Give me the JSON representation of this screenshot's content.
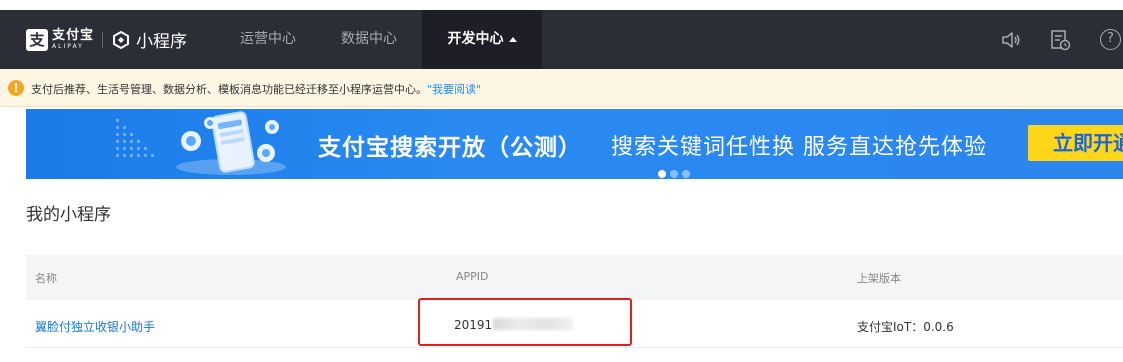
{
  "brand": {
    "alipay_mark": "支",
    "alipay_name": "支付宝",
    "alipay_en": "ALIPAY",
    "product": "小程序"
  },
  "nav": {
    "tabs": [
      {
        "label": "运营中心"
      },
      {
        "label": "数据中心"
      },
      {
        "label": "开发中心",
        "active": true
      }
    ],
    "icons": [
      "speaker-icon",
      "document-clock-icon",
      "help-icon"
    ],
    "help_glyph": "?"
  },
  "notice": {
    "icon_glyph": "!",
    "text": "支付后推荐、生活号管理、数据分析、模板消息功能已经迁移至小程序运营中心。",
    "link": "\"我要阅读\""
  },
  "banner": {
    "title": "支付宝搜索开放（公测）",
    "subtitle": "搜索关键词任性换 服务直达抢先体验",
    "cta": "立即开通",
    "slides": 3,
    "active_slide": 1
  },
  "section": {
    "title": "我的小程序"
  },
  "table": {
    "columns": [
      "名称",
      "APPID",
      "上架版本"
    ],
    "rows": [
      {
        "name": "翼脸付独立收银小助手",
        "appid_visible": "20191",
        "version": "支付宝IoT：0.0.6"
      }
    ]
  },
  "colors": {
    "nav_bg": "#2b2d37",
    "banner_blue": "#2a8af2",
    "cta_yellow": "#ffd71a",
    "link_blue": "#1677d2",
    "highlight_red": "#e02020"
  }
}
